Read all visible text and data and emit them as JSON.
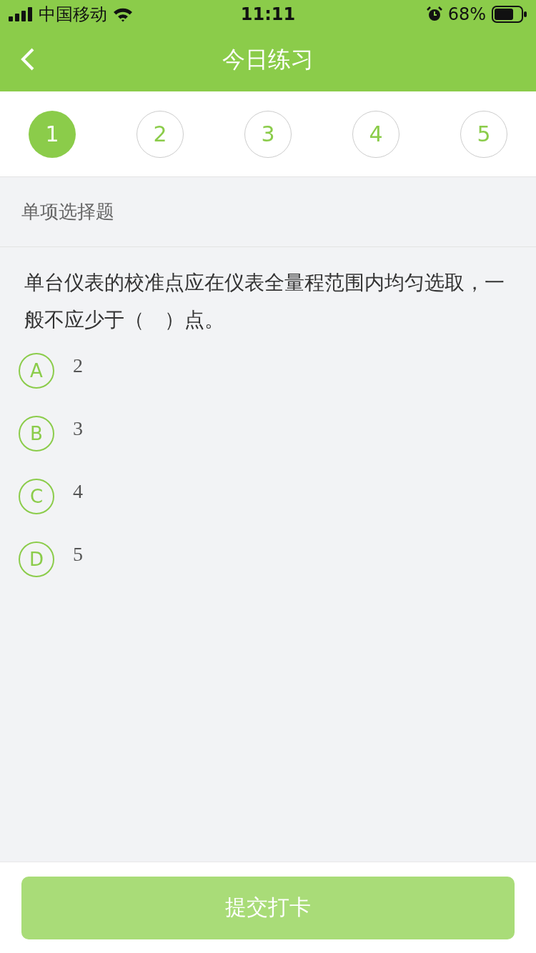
{
  "status_bar": {
    "carrier": "中国移动",
    "time": "11:11",
    "battery": "68%"
  },
  "nav": {
    "title": "今日练习"
  },
  "steps": [
    {
      "label": "1",
      "selected": true
    },
    {
      "label": "2",
      "selected": false
    },
    {
      "label": "3",
      "selected": false
    },
    {
      "label": "4",
      "selected": false
    },
    {
      "label": "5",
      "selected": false
    }
  ],
  "section": "单项选择题",
  "question": "单台仪表的校准点应在仪表全量程范围内均匀选取，一般不应少于（　）点。",
  "options": [
    {
      "letter": "A",
      "value": "2",
      "selected": false
    },
    {
      "letter": "B",
      "value": "3",
      "selected": false
    },
    {
      "letter": "C",
      "value": "4",
      "selected": false
    },
    {
      "letter": "D",
      "value": "5",
      "selected": false
    }
  ],
  "submit": {
    "label": "提交打卡",
    "disabled": true
  }
}
